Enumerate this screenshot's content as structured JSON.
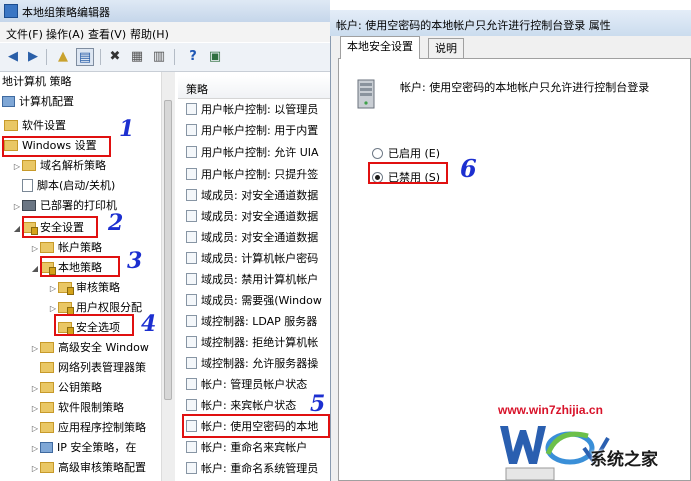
{
  "main_window": {
    "title": "本地组策略编辑器",
    "menu": [
      "文件(F)",
      "操作(A)",
      "查看(V)",
      "帮助(H)"
    ]
  },
  "tree": {
    "items": [
      {
        "label": "地计算机 策略",
        "icon": "computer-icon"
      },
      {
        "label": "计算机配置",
        "icon": "computer-icon"
      },
      {
        "label": "软件设置",
        "icon": "folder-icon"
      },
      {
        "label": "Windows 设置",
        "icon": "folder-icon"
      },
      {
        "label": "域名解析策略",
        "icon": "folder-icon"
      },
      {
        "label": "脚本(启动/关机)",
        "icon": "document-icon"
      },
      {
        "label": "已部署的打印机",
        "icon": "printer-icon"
      },
      {
        "label": "安全设置",
        "icon": "security-folder-icon"
      },
      {
        "label": "帐户策略",
        "icon": "folder-icon"
      },
      {
        "label": "本地策略",
        "icon": "security-folder-icon"
      },
      {
        "label": "审核策略",
        "icon": "security-folder-icon"
      },
      {
        "label": "用户权限分配",
        "icon": "security-folder-icon"
      },
      {
        "label": "安全选项",
        "icon": "security-folder-icon"
      },
      {
        "label": "高级安全 Window",
        "icon": "folder-icon"
      },
      {
        "label": "网络列表管理器策",
        "icon": "folder-icon"
      },
      {
        "label": "公钥策略",
        "icon": "folder-icon"
      },
      {
        "label": "软件限制策略",
        "icon": "folder-icon"
      },
      {
        "label": "应用程序控制策略",
        "icon": "folder-icon"
      },
      {
        "label": "IP 安全策略，在",
        "icon": "pc-icon"
      },
      {
        "label": "高级审核策略配置",
        "icon": "folder-icon"
      }
    ]
  },
  "list": {
    "header": "策略",
    "rows": [
      "用户帐户控制: 以管理员",
      "用户帐户控制: 用于内置",
      "用户帐户控制: 允许 UIA",
      "用户帐户控制: 只提升签",
      "域成员: 对安全通道数据",
      "域成员: 对安全通道数据",
      "域成员: 对安全通道数据",
      "域成员: 计算机帐户密码",
      "域成员: 禁用计算机帐户",
      "域成员: 需要强(Window",
      "域控制器: LDAP 服务器",
      "域控制器: 拒绝计算机帐",
      "域控制器: 允许服务器操",
      "帐户: 管理员帐户状态",
      "帐户: 来宾帐户状态",
      "帐户: 使用空密码的本地",
      "帐户: 重命名来宾帐户",
      "帐户: 重命名系统管理员"
    ]
  },
  "dialog": {
    "title": "帐户: 使用空密码的本地帐户只允许进行控制台登录 属性",
    "tabs": [
      "本地安全设置",
      "说明"
    ],
    "heading": "帐户: 使用空密码的本地帐户只允许进行控制台登录",
    "options": [
      {
        "label": "已启用 (E)",
        "selected": false
      },
      {
        "label": "已禁用 (S)",
        "selected": true
      }
    ]
  },
  "annotations": [
    "1",
    "2",
    "3",
    "4",
    "5",
    "6"
  ],
  "watermark": {
    "url": "www.win7zhijia.cn",
    "brand": "系统之家"
  },
  "colors": {
    "highlight_box": "#e01010",
    "annotation_number": "#1c2fd0",
    "watermark_url": "#d8132a"
  }
}
